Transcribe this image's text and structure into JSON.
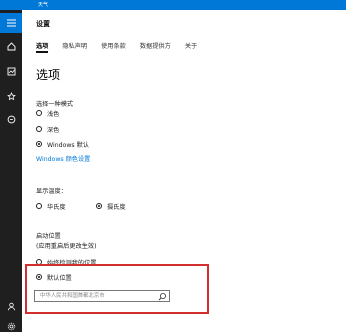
{
  "window": {
    "title": "天气"
  },
  "header": {
    "title": "设置"
  },
  "tabs": [
    {
      "label": "选项"
    },
    {
      "label": "隐私声明"
    },
    {
      "label": "使用条款"
    },
    {
      "label": "数据提供方"
    },
    {
      "label": "关于"
    }
  ],
  "page": {
    "section_title": "选项"
  },
  "mode": {
    "label": "选择一种模式",
    "options": [
      "浅色",
      "深色",
      "Windows 默认"
    ],
    "selected": "Windows 默认",
    "link": "Windows 颜色设置"
  },
  "temperature": {
    "label": "显示温度：",
    "options": [
      "华氏度",
      "摄氏度"
    ],
    "selected": "摄氏度"
  },
  "location": {
    "label": "启动位置",
    "sublabel": "(应用重启后更改生效)",
    "options": [
      "始终检测我的位置",
      "默认位置"
    ],
    "selected": "默认位置",
    "search_placeholder": "中华人民共和国首都北京市"
  },
  "colors": {
    "accent": "#0078d7",
    "highlight": "#d32f2f"
  }
}
